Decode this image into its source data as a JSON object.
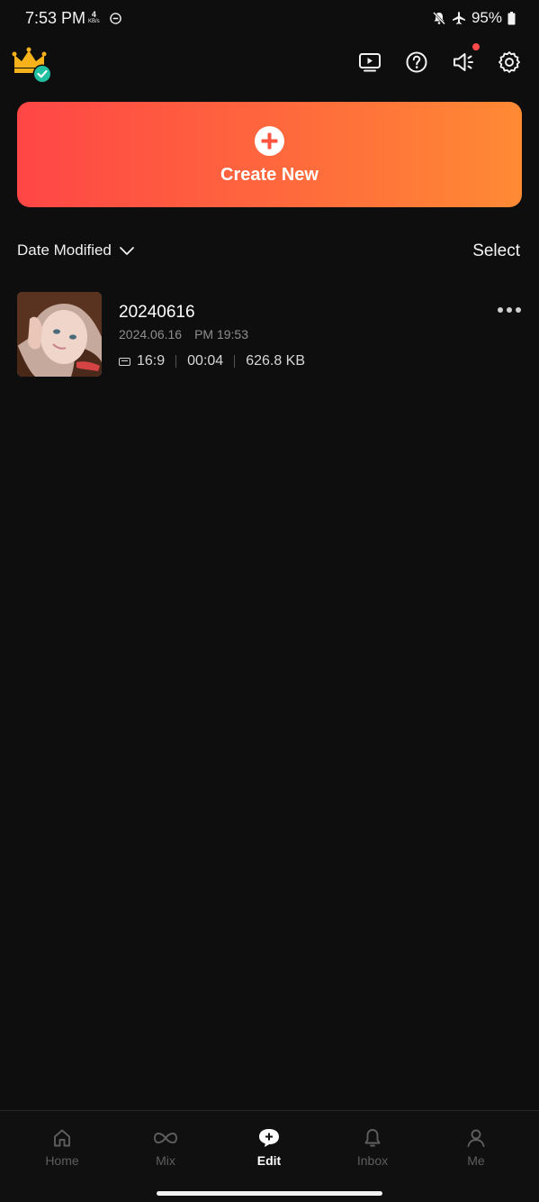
{
  "status_bar": {
    "time": "7:53 PM",
    "net_speed_value": "4",
    "net_speed_unit": "KB/s",
    "battery": "95%"
  },
  "header": {
    "icons": [
      "crown-vip-icon",
      "video-tutorial-icon",
      "help-icon",
      "announcement-icon",
      "settings-icon"
    ],
    "has_notification": true
  },
  "create_new": {
    "label": "Create New"
  },
  "list_header": {
    "sort_label": "Date Modified",
    "select_label": "Select"
  },
  "projects": [
    {
      "title": "20240616",
      "date": "2024.06.16",
      "time": "PM 19:53",
      "ratio": "16:9",
      "duration": "00:04",
      "size": "626.8 KB"
    }
  ],
  "nav": {
    "items": [
      {
        "label": "Home",
        "icon": "home-icon"
      },
      {
        "label": "Mix",
        "icon": "infinity-icon"
      },
      {
        "label": "Edit",
        "icon": "plus-bubble-icon"
      },
      {
        "label": "Inbox",
        "icon": "bell-icon"
      },
      {
        "label": "Me",
        "icon": "person-icon"
      }
    ],
    "active": "Edit"
  },
  "colors": {
    "background": "#0e0e0e",
    "accent_start": "#ff4646",
    "accent_end": "#ff8a34",
    "notification": "#ff4a4a",
    "vip_badge": "#1fbfa0",
    "crown": "#f6b21b"
  }
}
